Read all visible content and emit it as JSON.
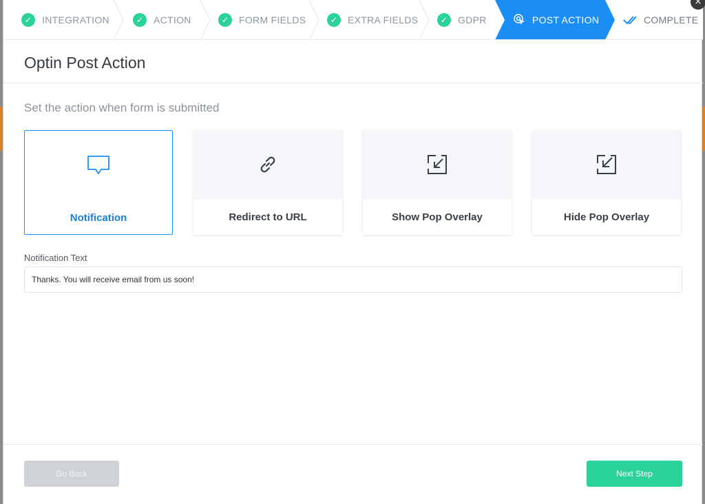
{
  "steps": [
    {
      "label": "INTEGRATION",
      "state": "done"
    },
    {
      "label": "ACTION",
      "state": "done"
    },
    {
      "label": "FORM FIELDS",
      "state": "done"
    },
    {
      "label": "EXTRA FIELDS",
      "state": "done"
    },
    {
      "label": "GDPR",
      "state": "done"
    },
    {
      "label": "POST ACTION",
      "state": "active"
    },
    {
      "label": "COMPLETE",
      "state": "pending"
    }
  ],
  "header": {
    "title": "Optin Post Action"
  },
  "main": {
    "subtitle": "Set the action when form is submitted",
    "options": [
      {
        "label": "Notification",
        "icon": "chat-bubble-icon",
        "selected": true
      },
      {
        "label": "Redirect to URL",
        "icon": "link-icon",
        "selected": false
      },
      {
        "label": "Show Pop Overlay",
        "icon": "arrow-in-box-icon",
        "selected": false
      },
      {
        "label": "Hide Pop Overlay",
        "icon": "arrow-out-box-icon",
        "selected": false
      }
    ],
    "notification_label": "Notification Text",
    "notification_value": "Thanks. You will receive email from us soon!"
  },
  "footer": {
    "back_label": "Go Back",
    "next_label": "Next Step"
  },
  "colors": {
    "accent": "#1b8ef5",
    "success": "#2bd39a",
    "muted_button": "#cfd3d7"
  }
}
